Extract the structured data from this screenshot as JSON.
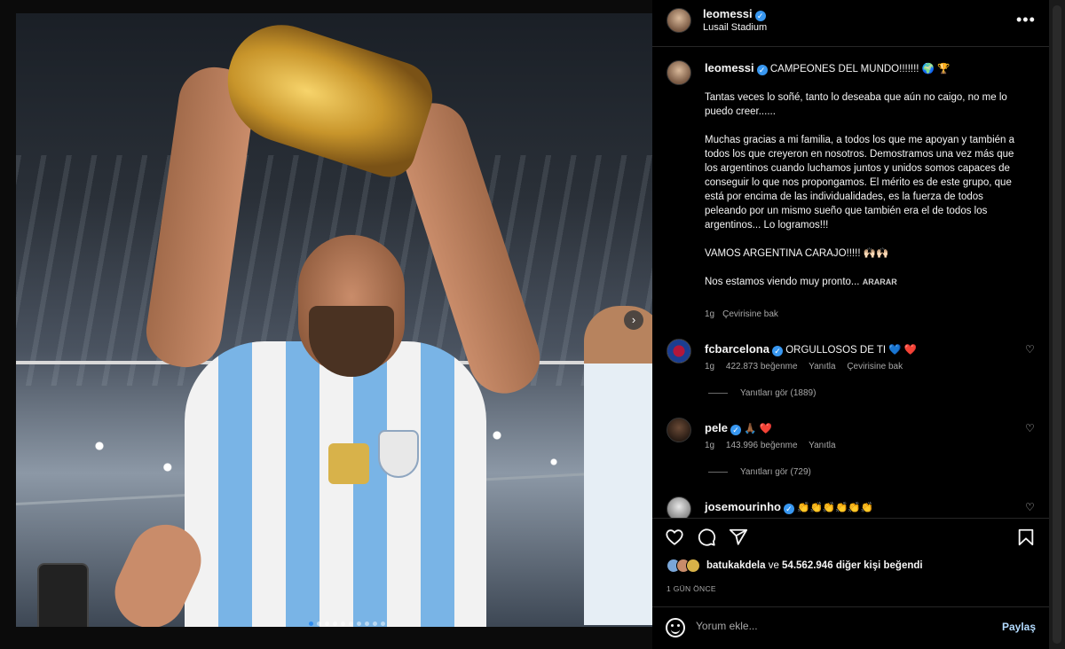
{
  "post": {
    "username": "leomessi",
    "location": "Lusail Stadium",
    "caption_headline": "CAMPEONES DEL MUNDO!!!!!!! 🌍 🏆",
    "caption_p1": "Tantas veces lo soñé, tanto lo deseaba que aún no caigo, no me lo puedo creer......",
    "caption_p2": "Muchas gracias a mi familia, a todos los que me apoyan y también a todos los que creyeron en nosotros. Demostramos una vez más que los argentinos cuando luchamos juntos y unidos somos capaces de conseguir lo que nos propongamos. El mérito es de este grupo, que está por encima de las individualidades, es la fuerza de todos peleando por un mismo sueño que también era el de todos los argentinos... Lo logramos!!!",
    "caption_p3": "VAMOS ARGENTINA CARAJO!!!!! 🙌🏻🙌🏻",
    "caption_p4": "Nos estamos viendo muy pronto...",
    "more_label": "ARARAR",
    "age": "1g",
    "translate_label": "Çevirisine bak",
    "photo_alt": "Messi holding World Cup trophy",
    "carousel_dots": 10,
    "carousel_active": 0
  },
  "comments": [
    {
      "username": "fcbarcelona",
      "text": "ORGULLOSOS DE TI 💙 ❤️",
      "age": "1g",
      "likes": "422.873 beğenme",
      "reply": "Yanıtla",
      "translate": "Çevirisine bak",
      "replies": "Yanıtları gör (1889)"
    },
    {
      "username": "pele",
      "text": "🙏🏾 ❤️",
      "age": "1g",
      "likes": "143.996 beğenme",
      "reply": "Yanıtla",
      "replies": "Yanıtları gör (729)"
    },
    {
      "username": "josemourinho",
      "text": "👏👏👏👏👏👏"
    }
  ],
  "likes": {
    "first_liker": "batukakdela",
    "connector": "ve",
    "count": "54.562.946",
    "suffix": "diğer kişi beğendi"
  },
  "time_label": "1 GÜN ÖNCE",
  "comment_input": {
    "placeholder": "Yorum ekle...",
    "value": ""
  },
  "post_button": "Paylaş",
  "icons": {
    "like": "heart-outline",
    "comment": "speech-bubble",
    "share": "paper-plane",
    "save": "bookmark",
    "more": "ellipsis",
    "next": "chevron-right"
  },
  "colors": {
    "verified": "#3897f0",
    "post_button": "#b3dbff",
    "heart_red": "#ed2e43"
  }
}
